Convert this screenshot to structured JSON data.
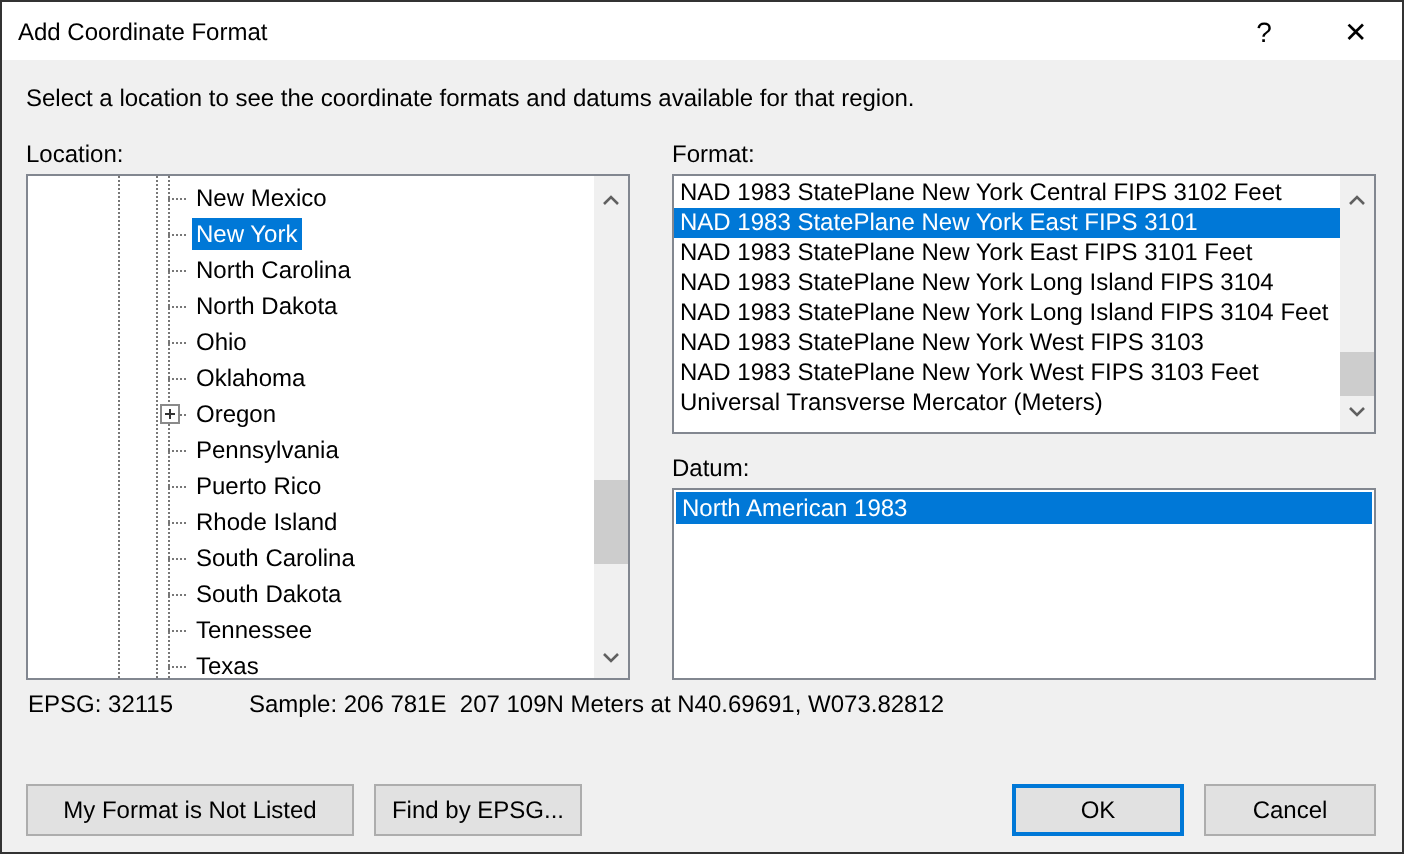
{
  "window": {
    "title": "Add Coordinate Format",
    "help": "?",
    "close": "✕"
  },
  "instructions": "Select a location to see the coordinate formats and datums available for that region.",
  "location": {
    "label": "Location:",
    "items": [
      {
        "label": "New Mexico",
        "selected": false,
        "expandable": false
      },
      {
        "label": "New York",
        "selected": true,
        "expandable": false
      },
      {
        "label": "North Carolina",
        "selected": false,
        "expandable": false
      },
      {
        "label": "North Dakota",
        "selected": false,
        "expandable": false
      },
      {
        "label": "Ohio",
        "selected": false,
        "expandable": false
      },
      {
        "label": "Oklahoma",
        "selected": false,
        "expandable": false
      },
      {
        "label": "Oregon",
        "selected": false,
        "expandable": true
      },
      {
        "label": "Pennsylvania",
        "selected": false,
        "expandable": false
      },
      {
        "label": "Puerto Rico",
        "selected": false,
        "expandable": false
      },
      {
        "label": "Rhode Island",
        "selected": false,
        "expandable": false
      },
      {
        "label": "South Carolina",
        "selected": false,
        "expandable": false
      },
      {
        "label": "South Dakota",
        "selected": false,
        "expandable": false
      },
      {
        "label": "Tennessee",
        "selected": false,
        "expandable": false
      },
      {
        "label": "Texas",
        "selected": false,
        "expandable": false
      }
    ]
  },
  "format": {
    "label": "Format:",
    "items": [
      {
        "label": "NAD 1983 StatePlane New York Central FIPS 3102 Feet",
        "selected": false
      },
      {
        "label": "NAD 1983 StatePlane New York East FIPS 3101",
        "selected": true
      },
      {
        "label": "NAD 1983 StatePlane New York East FIPS 3101 Feet",
        "selected": false
      },
      {
        "label": "NAD 1983 StatePlane New York Long Island FIPS 3104",
        "selected": false
      },
      {
        "label": "NAD 1983 StatePlane New York Long Island FIPS 3104 Feet",
        "selected": false
      },
      {
        "label": "NAD 1983 StatePlane New York West FIPS 3103",
        "selected": false
      },
      {
        "label": "NAD 1983 StatePlane New York West FIPS 3103 Feet",
        "selected": false
      },
      {
        "label": "Universal Transverse Mercator (Meters)",
        "selected": false
      }
    ]
  },
  "datum": {
    "label": "Datum:",
    "items": [
      {
        "label": "North American 1983",
        "selected": true
      }
    ]
  },
  "status": {
    "epsg": "EPSG: 32115",
    "sample": "Sample: 206 781E  207 109N Meters at N40.69691, W073.82812"
  },
  "buttons": [
    {
      "label": "My Format is Not Listed",
      "default": false
    },
    {
      "label": "Find by EPSG...",
      "default": false
    },
    {
      "label": "OK",
      "default": true
    },
    {
      "label": "Cancel",
      "default": false
    }
  ]
}
